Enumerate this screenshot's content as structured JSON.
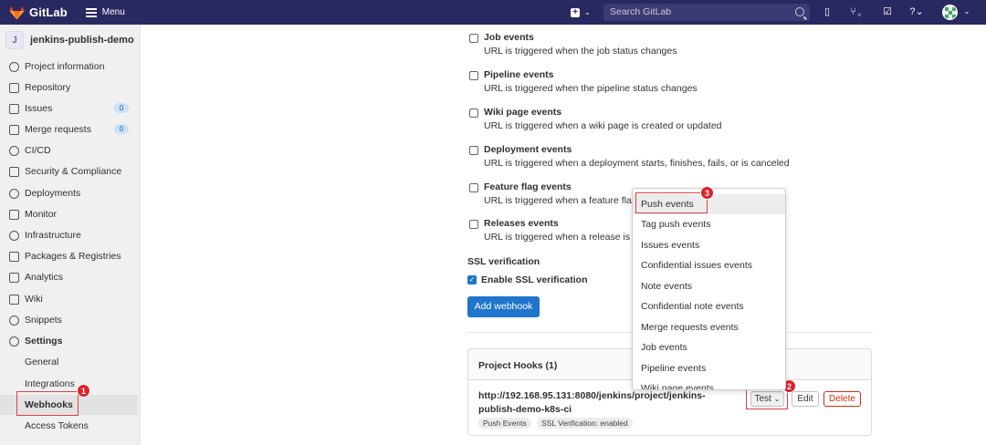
{
  "topbar": {
    "brand": "GitLab",
    "menu_label": "Menu",
    "search_placeholder": "Search GitLab"
  },
  "sidebar": {
    "project_initial": "J",
    "project_name": "jenkins-publish-demo",
    "items": [
      {
        "label": "Project information",
        "icon": "info-icon"
      },
      {
        "label": "Repository",
        "icon": "book-icon"
      },
      {
        "label": "Issues",
        "icon": "issues-icon",
        "badge": "0"
      },
      {
        "label": "Merge requests",
        "icon": "merge-request-icon",
        "badge": "0"
      },
      {
        "label": "CI/CD",
        "icon": "rocket-icon"
      },
      {
        "label": "Security & Compliance",
        "icon": "shield-icon"
      },
      {
        "label": "Deployments",
        "icon": "deployments-icon"
      },
      {
        "label": "Monitor",
        "icon": "monitor-icon"
      },
      {
        "label": "Infrastructure",
        "icon": "cloud-icon"
      },
      {
        "label": "Packages & Registries",
        "icon": "package-icon"
      },
      {
        "label": "Analytics",
        "icon": "chart-icon"
      },
      {
        "label": "Wiki",
        "icon": "wiki-icon"
      },
      {
        "label": "Snippets",
        "icon": "scissors-icon"
      },
      {
        "label": "Settings",
        "icon": "settings-icon"
      }
    ],
    "settings_sub": [
      "General",
      "Integrations",
      "Webhooks",
      "Access Tokens"
    ]
  },
  "events": [
    {
      "title": "Job events",
      "desc": "URL is triggered when the job status changes"
    },
    {
      "title": "Pipeline events",
      "desc": "URL is triggered when the pipeline status changes"
    },
    {
      "title": "Wiki page events",
      "desc": "URL is triggered when a wiki page is created or updated"
    },
    {
      "title": "Deployment events",
      "desc": "URL is triggered when a deployment starts, finishes, fails, or is canceled"
    },
    {
      "title": "Feature flag events",
      "desc": "URL is triggered when a feature flag"
    },
    {
      "title": "Releases events",
      "desc": "URL is triggered when a release is c"
    }
  ],
  "ssl": {
    "title": "SSL verification",
    "label": "Enable SSL verification",
    "checked": true
  },
  "add_webhook_label": "Add webhook",
  "hooks": {
    "header": "Project Hooks (1)",
    "url": "http://192.168.95.131:8080/jenkins/project/jenkins-publish-demo-k8s-ci",
    "badges": [
      "Push Events",
      "SSL Verification: enabled"
    ],
    "test_label": "Test",
    "edit_label": "Edit",
    "delete_label": "Delete"
  },
  "test_dropdown": {
    "items": [
      "Push events",
      "Tag push events",
      "Issues events",
      "Confidential issues events",
      "Note events",
      "Confidential note events",
      "Merge requests events",
      "Job events",
      "Pipeline events",
      "Wiki page events"
    ]
  },
  "annotations": [
    "1",
    "2",
    "3"
  ],
  "colors": {
    "topbar": "#292961",
    "primary": "#1f75cb",
    "danger": "#dd2b0e",
    "annotation": "#e0202a"
  }
}
